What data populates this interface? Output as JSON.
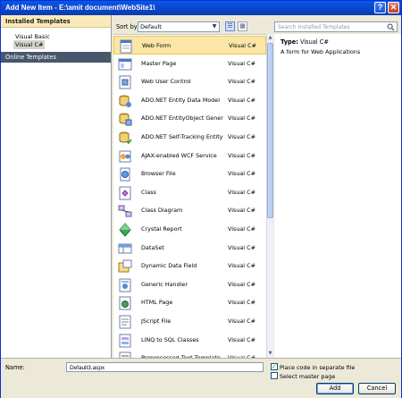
{
  "window": {
    "title": "Add New Item - E:\\amit document\\WebSite1\\"
  },
  "left_panel": {
    "header": "Installed Templates",
    "items": [
      {
        "label": "Visual Basic",
        "selected": false
      },
      {
        "label": "Visual C#",
        "selected": true
      }
    ],
    "online": "Online Templates"
  },
  "toolbar": {
    "sort_label": "Sort by:",
    "sort_value": "Default"
  },
  "search": {
    "placeholder": "Search Installed Templates"
  },
  "templates": [
    {
      "name": "Web Form",
      "lang": "Visual C#",
      "icon": "web-form-icon",
      "selected": true
    },
    {
      "name": "Master Page",
      "lang": "Visual C#",
      "icon": "master-page-icon"
    },
    {
      "name": "Web User Control",
      "lang": "Visual C#",
      "icon": "user-control-icon"
    },
    {
      "name": "ADO.NET Entity Data Model",
      "lang": "Visual C#",
      "icon": "entity-model-icon"
    },
    {
      "name": "ADO.NET EntityObject Generator",
      "lang": "Visual C#",
      "icon": "entity-generator-icon"
    },
    {
      "name": "ADO.NET Self-Tracking Entity Ge...",
      "lang": "Visual C#",
      "icon": "self-tracking-icon"
    },
    {
      "name": "AJAX-enabled WCF Service",
      "lang": "Visual C#",
      "icon": "wcf-service-icon"
    },
    {
      "name": "Browser File",
      "lang": "Visual C#",
      "icon": "browser-file-icon"
    },
    {
      "name": "Class",
      "lang": "Visual C#",
      "icon": "class-icon"
    },
    {
      "name": "Class Diagram",
      "lang": "Visual C#",
      "icon": "class-diagram-icon"
    },
    {
      "name": "Crystal Report",
      "lang": "Visual C#",
      "icon": "crystal-report-icon"
    },
    {
      "name": "DataSet",
      "lang": "Visual C#",
      "icon": "dataset-icon"
    },
    {
      "name": "Dynamic Data Field",
      "lang": "Visual C#",
      "icon": "dynamic-data-icon"
    },
    {
      "name": "Generic Handler",
      "lang": "Visual C#",
      "icon": "generic-handler-icon"
    },
    {
      "name": "HTML Page",
      "lang": "Visual C#",
      "icon": "html-page-icon"
    },
    {
      "name": "JScript File",
      "lang": "Visual C#",
      "icon": "jscript-file-icon"
    },
    {
      "name": "LINQ to SQL Classes",
      "lang": "Visual C#",
      "icon": "linq-icon"
    },
    {
      "name": "Preprocessed Text Template",
      "lang": "Visual C#",
      "icon": "text-template-icon"
    }
  ],
  "details": {
    "type_label": "Type:",
    "type_value": "Visual C#",
    "description": "A form for Web Applications"
  },
  "bottom": {
    "name_label": "Name:",
    "name_value": "Default3.aspx",
    "place_code_label": "Place code in separate file",
    "place_code_checked": true,
    "master_page_label": "Select master page",
    "master_page_checked": false,
    "add_label": "Add",
    "cancel_label": "Cancel"
  },
  "colors": {
    "title_bar": "#0b44c4",
    "selection": "#fbe6a8",
    "online_bar": "#49566b",
    "header": "#faeab8"
  }
}
